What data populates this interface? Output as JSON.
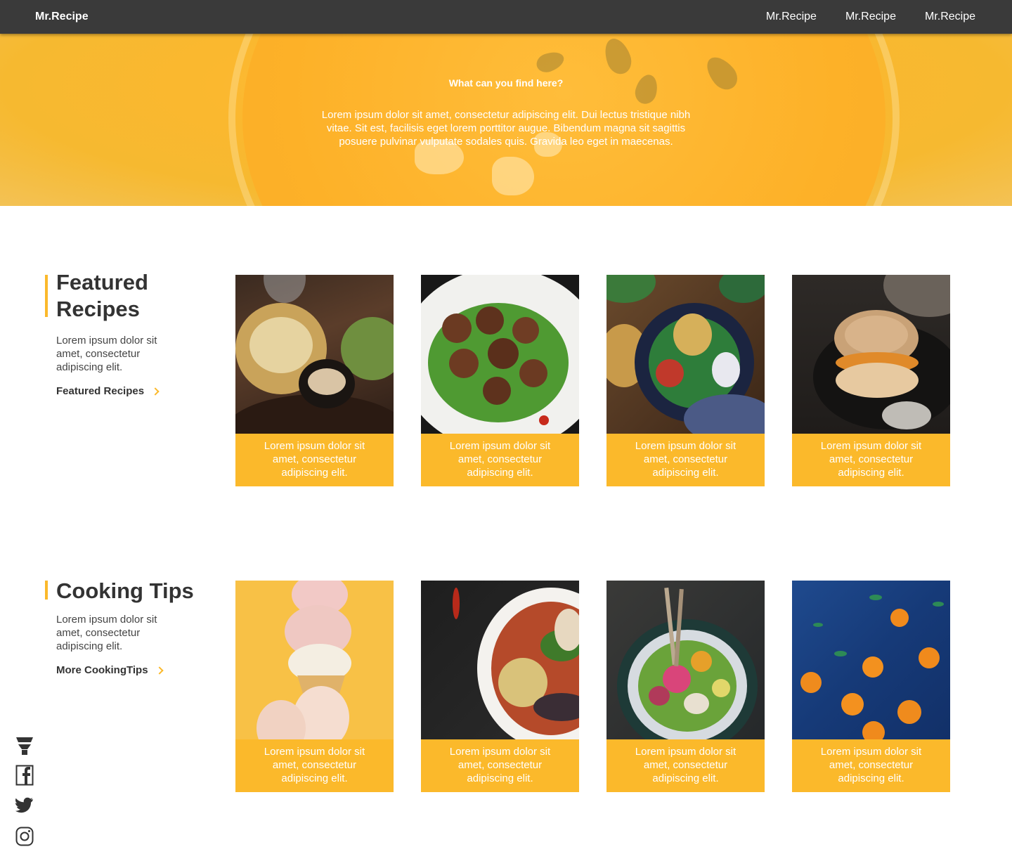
{
  "nav": {
    "brand": "Mr.Recipe",
    "links": [
      "Mr.Recipe",
      "Mr.Recipe",
      "Mr.Recipe"
    ]
  },
  "hero": {
    "title": "What can you find here?",
    "text": "Lorem ipsum dolor sit amet, consectetur adipiscing elit. Dui lectus tristique nibh vitae. Sit est, facilisis eget lorem porttitor augue. Bibendum magna sit sagittis posuere pulvinar vulputate sodales quis. Gravida leo eget in maecenas."
  },
  "featured": {
    "title": "Featured Recipes",
    "description": "Lorem ipsum dolor sit amet, consectetur adipiscing elit.",
    "link": "Featured Recipes",
    "cards": [
      {
        "caption": "Lorem ipsum dolor sit amet, consectetur adipiscing elit."
      },
      {
        "caption": "Lorem ipsum dolor sit amet, consectetur adipiscing elit."
      },
      {
        "caption": "Lorem ipsum dolor sit amet, consectetur adipiscing elit."
      },
      {
        "caption": "Lorem ipsum dolor sit amet, consectetur adipiscing elit."
      }
    ]
  },
  "tips": {
    "title": "Cooking Tips",
    "description": "Lorem ipsum dolor sit amet, consectetur adipiscing elit.",
    "link": "More CookingTips",
    "cards": [
      {
        "caption": "Lorem ipsum dolor sit amet, consectetur adipiscing elit."
      },
      {
        "caption": "Lorem ipsum dolor sit amet, consectetur adipiscing elit."
      },
      {
        "caption": "Lorem ipsum dolor sit amet, consectetur adipiscing elit."
      },
      {
        "caption": "Lorem ipsum dolor sit amet, consectetur adipiscing elit."
      }
    ]
  },
  "social": {
    "icons": [
      "funnel-icon",
      "facebook-icon",
      "twitter-icon",
      "instagram-icon"
    ]
  },
  "colors": {
    "accent": "#fbb92b",
    "nav_bg": "#3a3a3a",
    "text": "#333333"
  }
}
